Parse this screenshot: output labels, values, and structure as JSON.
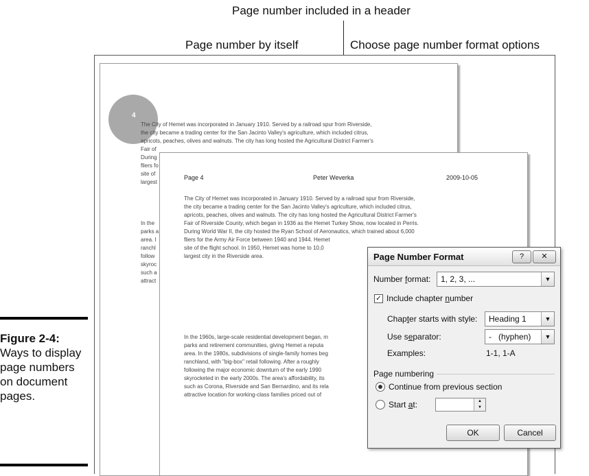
{
  "callouts": {
    "header": "Page number included in a header",
    "itself": "Page number by itself",
    "format": "Choose page number format options"
  },
  "caption": {
    "label": "Figure 2-4:",
    "text": "Ways to display page numbers on document pages."
  },
  "back_page": {
    "page_number": "4",
    "paragraph1": [
      "The City of Hemet was incorporated in January 1910. Served by a railroad spur from Riverside,",
      "the city became a trading center for the San Jacinto Valley's agriculture, which included citrus,",
      "apricots, peaches, olives and walnuts. The city has long hosted the Agricultural District Farmer's",
      "Fair of",
      "During",
      "fliers fo",
      "site of",
      "largest"
    ],
    "paragraph2": [
      "In the",
      "parks a",
      "area. I",
      "ranchl",
      "follow",
      "skyroc",
      "such a",
      "attract"
    ]
  },
  "front_page": {
    "header_left": "Page 4",
    "header_center": "Peter Weverka",
    "header_right": "2009-10-05",
    "paragraph1": [
      "The City of Hemet was incorporated in January 1910. Served by a railroad spur from Riverside,",
      "the city became a trading center for the San Jacinto Valley's agriculture, which included citrus,",
      "apricots, peaches, olives and walnuts. The city has long hosted the Agricultural District Farmer's",
      "Fair of Riverside County, which began in 1936 as the Hemet Turkey Show, now located in Perris.",
      "During World War II, the city hosted the Ryan School of Aeronautics, which trained about 6,000",
      "fliers for the Army Air Force between 1940 and 1944. Hemet",
      "site of the flight school. In 1950, Hemet was home to 10,0",
      "largest city in the Riverside area."
    ],
    "paragraph2": [
      "In the 1960s, large-scale residential development began, m",
      "parks and retirement communities, giving Hemet a reputa",
      "area. In the 1980s, subdivisions of single-family homes beg",
      "ranchland, with \"big-box\" retail following. After a roughly",
      "following the major economic downturn of the early 1990",
      "skyrocketed in the early 2000s. The area's affordability, its",
      "such as Corona, Riverside and San Bernardino, and its rela",
      "attractive location for working-class families priced out of"
    ]
  },
  "dialog": {
    "title": "Page Number Format",
    "help_button": "?",
    "close_button": "✕",
    "number_format_label_pre": "Number ",
    "number_format_label_accel": "f",
    "number_format_label_post": "ormat:",
    "number_format_value": "1, 2, 3, ...",
    "include_chapter_pre": "Include chapter ",
    "include_chapter_accel": "n",
    "include_chapter_post": "umber",
    "include_chapter_checked": "✓",
    "chapter_style_pre": "Chap",
    "chapter_style_accel": "t",
    "chapter_style_post": "er starts with style:",
    "chapter_style_value": "Heading 1",
    "separator_pre": "Use s",
    "separator_accel": "e",
    "separator_post": "parator:",
    "separator_value": "-   (hyphen)",
    "examples_label": "Examples:",
    "examples_value": "1-1, 1-A",
    "page_numbering_label": "Page numbering",
    "continue_label": "Continue from previous section",
    "start_at_pre": "Start ",
    "start_at_accel": "a",
    "start_at_post": "t:",
    "start_at_value": "",
    "ok_button": "OK",
    "cancel_button": "Cancel"
  }
}
